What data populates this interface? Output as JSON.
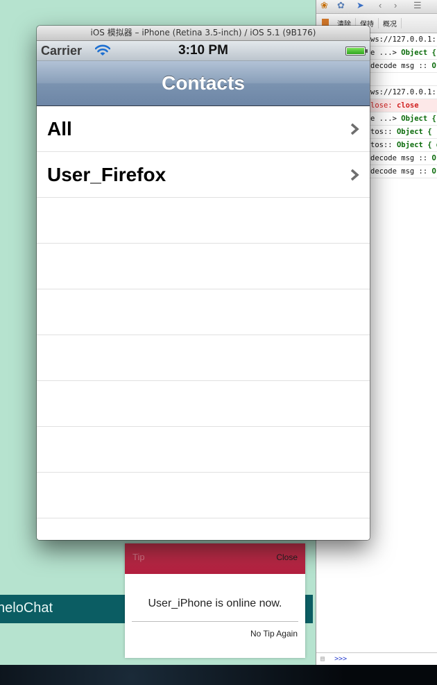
{
  "simulator": {
    "window_title": "iOS 模拟器 – iPhone (Retina 3.5-inch) / iOS 5.1 (9B176)"
  },
  "status_bar": {
    "carrier": "Carrier",
    "time": "3:10 PM",
    "wifi_icon": "wifi-icon",
    "battery_icon": "battery-icon",
    "battery_level": 1.0
  },
  "navbar": {
    "title": "Contacts"
  },
  "contacts": [
    {
      "label": "All"
    },
    {
      "label": "User_Firefox"
    }
  ],
  "tip": {
    "title": "Tip",
    "close_label": "Close",
    "message": "User_iPhone is online now.",
    "no_tip_label": "No Tip Again"
  },
  "background_page": {
    "banner_text": "neloChat"
  },
  "devtools": {
    "toolbar": {
      "clear_label": "清除",
      "persist_label": "保持",
      "profile_label": "概况"
    },
    "log": [
      {
        "text": "ws://127.0.0.1:",
        "kind": "plain"
      },
      {
        "text": "e ...> ",
        "obj": "Object {",
        "kind": "obj"
      },
      {
        "text": "decode msg :: ",
        "obj": "O",
        "kind": "obj"
      },
      {
        "text": "",
        "kind": "blank"
      },
      {
        "text": "ws://127.0.0.1:",
        "kind": "plain"
      },
      {
        "text": "lose: ",
        "obj": "close",
        "kind": "err"
      },
      {
        "text": "e ...> ",
        "obj": "Object {",
        "kind": "obj"
      },
      {
        "text": "tos:: ",
        "obj": "Object { ]",
        "kind": "obj"
      },
      {
        "text": "tos:: ",
        "obj": "Object { d",
        "kind": "obj"
      },
      {
        "text": "decode msg :: ",
        "obj": "O",
        "kind": "obj"
      },
      {
        "text": "decode msg :: ",
        "obj": "O",
        "kind": "obj"
      }
    ],
    "command_prompt": ">>>"
  },
  "colors": {
    "page_background": "#b6e3cf",
    "banner": "#0b5d63",
    "tip_header": "#b21f3f",
    "navbar": "#7b93b0"
  }
}
